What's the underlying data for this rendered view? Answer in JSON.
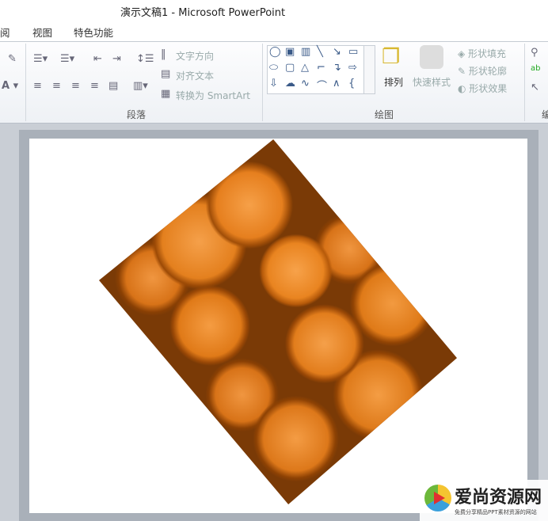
{
  "title": "演示文稿1  -  Microsoft PowerPoint",
  "tabs": [
    "阅",
    "视图",
    "特色功能"
  ],
  "paragraph": {
    "text_direction": "文字方向",
    "align_text": "对齐文本",
    "convert_smartart": "转换为 SmartArt",
    "label": "段落"
  },
  "drawing": {
    "arrange": "排列",
    "quick_styles": "快速样式",
    "shape_fill": "形状填充",
    "shape_outline": "形状轮廓",
    "shape_effects": "形状效果",
    "label": "绘图"
  },
  "editing": {
    "label": "编"
  },
  "watermark": {
    "name": "爱尚资源网",
    "tagline": "免费分享精品PPT素材资源的网站"
  }
}
